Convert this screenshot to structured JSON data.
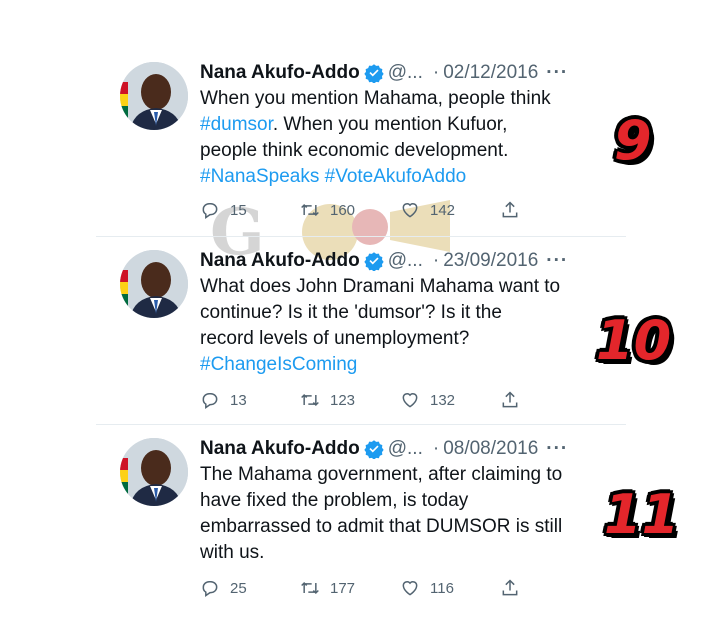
{
  "tweets": [
    {
      "name": "Nana Akufo-Addo",
      "handle": "@...",
      "date": "02/12/2016",
      "more": "···",
      "text_parts": [
        "When you mention Mahama, people think",
        "#dumsor",
        ". When you mention Kufuor,",
        "people think economic development.",
        "#NanaSpeaks #VoteAkufoAddo"
      ],
      "replies": "15",
      "retweets": "160",
      "likes": "142",
      "badge": "9"
    },
    {
      "name": "Nana Akufo-Addo",
      "handle": "@...",
      "date": "23/09/2016",
      "more": "···",
      "text_parts": [
        "What does John Dramani Mahama want to",
        "continue? Is it the 'dumsor'? Is it the",
        "record levels of unemployment?",
        "#ChangeIsComing"
      ],
      "replies": "13",
      "retweets": "123",
      "likes": "132",
      "badge": "10"
    },
    {
      "name": "Nana Akufo-Addo",
      "handle": "@...",
      "date": "08/08/2016",
      "more": "···",
      "text_parts": [
        "The Mahama government, after claiming to",
        "have fixed the problem, is today",
        "embarrassed to admit that DUMSOR is still",
        "with us."
      ],
      "replies": "25",
      "retweets": "177",
      "likes": "116",
      "badge": "11"
    }
  ],
  "colors": {
    "link": "#1d9bf0",
    "muted": "#536471",
    "badge_red": "#e3262b",
    "verified": "#1d9bf0"
  },
  "icons": [
    "reply-icon",
    "retweet-icon",
    "like-icon",
    "share-icon",
    "verified-icon",
    "more-icon"
  ]
}
